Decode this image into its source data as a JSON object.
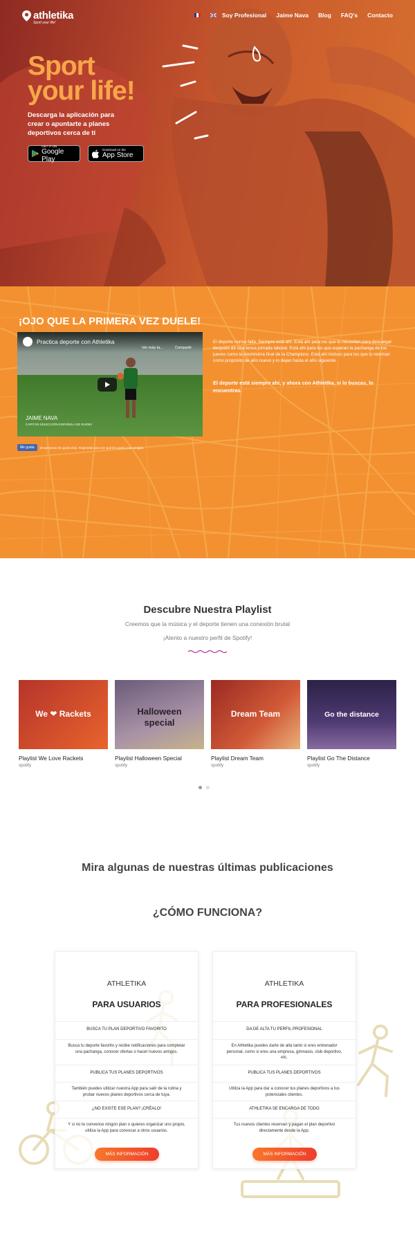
{
  "nav": {
    "logo": "athletika",
    "tagline": "Sport your life!",
    "links": [
      "Soy Profesional",
      "Jaime Nava",
      "Blog",
      "FAQ's",
      "Contacto"
    ]
  },
  "hero": {
    "title_line1": "Sport",
    "title_line2": "your life!",
    "subtitle": "Descarga la aplicación para crear o apuntarte a planes deportivos cerca de tí",
    "google_small": "GET IT ON",
    "google_big": "Google Play",
    "apple_small": "Download on the",
    "apple_big": "App Store"
  },
  "video_section": {
    "heading": "¡OJO QUE LA PRIMERA VEZ DUELE!",
    "video_title": "Practica deporte con Athletika",
    "watch_later": "Ver más ta...",
    "share": "Compartir",
    "caption_name": "JAIME NAVA",
    "caption_role": "CAPITÁN SELECCIÓN ESPAÑOLA DE RUGBY",
    "like_button": "Me gusta",
    "like_text": "29 personas les gusta esto. Regístrate para ver qué les gusta a tus amigos.",
    "paragraph": "El deporte nunca falla. Siempre está ahí. Está ahí para los que lo necesitan para descargar después de una tensa jornada laboral. Está ahí para los que esperan la pachanga de los jueves como la mismísima final de la Champions. Está ahí incluso para los que lo retoman como propósito de año nuevo y lo dejan hasta el año siguiente.",
    "paragraph_bold": "El deporte está siempre ahí, y ahora con Athletika, si lo buscas, lo encuentras."
  },
  "playlists": {
    "title": "Descubre Nuestra Playlist",
    "subtitle": "Creemos que la música y el deporte tienen una conexión brutal",
    "subtitle2": "¡Atento a nuestro perfil de Spotify!",
    "items": [
      {
        "image_text": "We ❤ Rackets",
        "name": "Playlist We Love Rackets",
        "source": "spotify"
      },
      {
        "image_text": "Halloween special",
        "name": "Playlist Halloween Special",
        "source": "spotify"
      },
      {
        "image_text": "Dream Team",
        "name": "Playlist Dream Team",
        "source": "spotify"
      },
      {
        "image_text": "Go the distance",
        "name": "Playlist Go The Distance",
        "source": "spotify"
      }
    ]
  },
  "publications_title": "Mira algunas de nuestras últimas publicaciones",
  "how_title": "¿CÓMO FUNCIONA?",
  "cards": [
    {
      "brand": "ATHLETIKA",
      "title": "PARA USUARIOS",
      "sections": [
        {
          "heading": "BUSCA TU PLAN DEPORTIVO FAVORITO",
          "text": "Busca tu deporte favorito y recibe notificaciones para completar una pachanga, conocer ofertas o hacer nuevos amigos."
        },
        {
          "heading": "PUBLICA TUS PLANES DEPORTIVOS",
          "text": "También puedes utilizar nuestra App para salir de la rutina y probar nuevos planes deportivos cerca de tuya."
        },
        {
          "heading": "¿NO EXISTE ESE PLAN? ¡CRÉALO!",
          "text": "Y si no te convence ningún plan o quieres organizar uno propio, utiliza la App para convocar a otros usuarios."
        }
      ],
      "button": "MÁS INFORMACIÓN"
    },
    {
      "brand": "ATHLETIKA",
      "title": "PARA PROFESIONALES",
      "sections": [
        {
          "heading": "DA DE ALTA TU PERFIL PROFESIONAL",
          "text": "En Athletika puedes darte de alta tanto si eres entrenador personal, como si eres una empresa, gimnasio, club deportivo, etc."
        },
        {
          "heading": "PUBLICA TUS PLANES DEPORTIVOS",
          "text": "Utiliza la App para dar a conocer tus planes deportivos a tus potenciales clientes."
        },
        {
          "heading": "ATHLETIKA SE ENCARGA DE TODO",
          "text": "Tus nuevos clientes reservan y pagan el plan deportivo directamente desde la App."
        }
      ],
      "button": "MÁS INFORMACIÓN"
    }
  ],
  "colors": {
    "hero_accent": "#f7a64a",
    "orange": "#f39131",
    "button_start": "#f8772a",
    "button_end": "#ee3e2c",
    "deco": "#e8dcb6"
  }
}
